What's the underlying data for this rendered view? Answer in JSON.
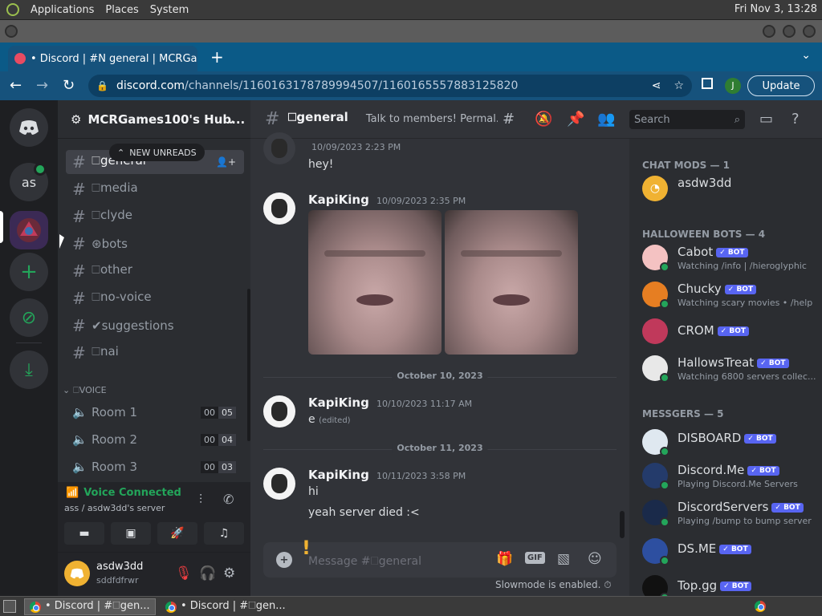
{
  "os": {
    "menu": [
      "Applications",
      "Places",
      "System"
    ],
    "clock": "Fri Nov  3, 13:28"
  },
  "browser": {
    "tab_title": "• Discord | #𝖭 general | MCRGa",
    "url_host": "discord.com",
    "url_path": "/channels/1160163178789994507/1160165557883125820",
    "profile_initial": "J",
    "update_label": "Update"
  },
  "rail": {
    "server_as": "as"
  },
  "sidebar": {
    "guild_name": "MCRGames100's Hub...",
    "new_unreads": "NEW UNREADS",
    "text_channels": [
      "🗆general",
      "🗆media",
      "🗆clyde",
      "⊛bots",
      "🗆other",
      "🗆no-voice",
      "✔suggestions",
      "🗆nai"
    ],
    "voice_category": "🗆VOICE",
    "voice_rooms": [
      {
        "name": "Room 1",
        "a": "00",
        "b": "05"
      },
      {
        "name": "Room 2",
        "a": "00",
        "b": "04"
      },
      {
        "name": "Room 3",
        "a": "00",
        "b": "03"
      }
    ],
    "voice_status": "Voice Connected",
    "voice_server": "ass / asdw3dd's server",
    "user_name": "asdw3dd",
    "user_tag": "sddfdfrwr"
  },
  "chat": {
    "channel": "🗆general",
    "topic": "Talk to members! Permal...",
    "search_placeholder": "Search",
    "messages": [
      {
        "time": "10/09/2023 2:23 PM",
        "text": "hey!"
      },
      {
        "author": "KapiKing",
        "time": "10/09/2023 2:35 PM"
      },
      {
        "author": "KapiKing",
        "time": "10/10/2023 11:17 AM",
        "text": "e",
        "edited": "(edited)"
      },
      {
        "author": "KapiKing",
        "time": "10/11/2023 3:58 PM",
        "text": "hi",
        "text2": "yeah server died :<"
      }
    ],
    "dividers": [
      "October 10, 2023",
      "October 11, 2023"
    ],
    "composer_placeholder": "Message #🗆general",
    "gif_label": "GIF",
    "slowmode": "Slowmode is enabled."
  },
  "members": {
    "categories": [
      "CHAT MODS — 1",
      "HALLOWEEN BOTS — 4",
      "MESSGERS — 5"
    ],
    "bot_label": "✓ BOT",
    "list": [
      {
        "name": "asdw3dd",
        "status": "",
        "color": "#f0b232"
      },
      {
        "name": "Cabot",
        "status": "Watching /info | /hieroglyphic",
        "color": "#f4c2c2"
      },
      {
        "name": "Chucky",
        "status": "Watching scary movies • /help",
        "color": "#e67e22"
      },
      {
        "name": "CROM",
        "status": "",
        "color": "#c0395b"
      },
      {
        "name": "HallowsTreat",
        "status": "Watching 6800 servers collec...",
        "color": "#e8e8e8"
      },
      {
        "name": "DISBOARD",
        "status": "",
        "color": "#dfe8f0"
      },
      {
        "name": "Discord.Me",
        "status": "Playing Discord.Me Servers",
        "color": "#243b6b"
      },
      {
        "name": "DiscordServers",
        "status": "Playing /bump to bump server",
        "color": "#1a2a4a"
      },
      {
        "name": "DS.ME",
        "status": "",
        "color": "#2d4fa0"
      },
      {
        "name": "Top.gg",
        "status": "",
        "color": "#111111"
      }
    ]
  },
  "taskbar": {
    "items": [
      "• Discord | #🗆gen...",
      "• Discord | #🗆gen..."
    ]
  }
}
